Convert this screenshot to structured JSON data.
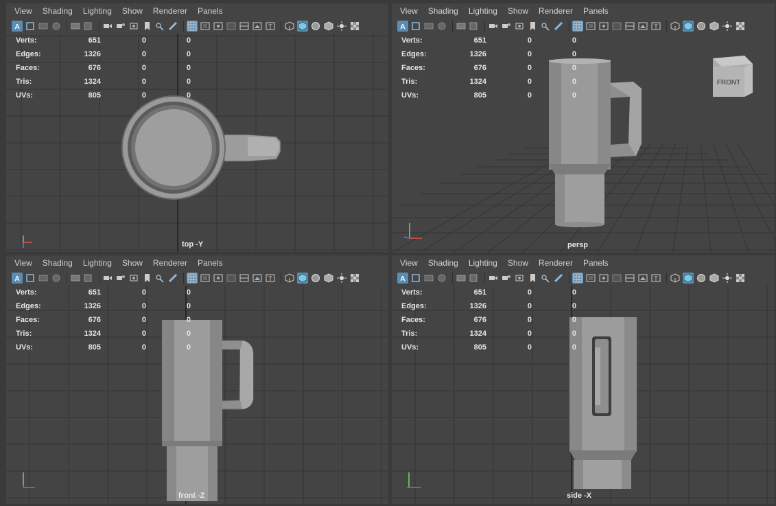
{
  "menus": [
    "View",
    "Shading",
    "Lighting",
    "Show",
    "Renderer",
    "Panels"
  ],
  "toolbar_icons": [
    "select-camera-icon",
    "camera-attributes-icon",
    "bookmark-icon",
    "image-plane-icon",
    "grid-toggle-icon",
    "film-gate-icon",
    "camera-icon",
    "camera-lock-icon",
    "snapshot-icon",
    "bookmark-flag-icon",
    "two-d-pan-icon",
    "grease-pencil-icon",
    "grid-icon",
    "film-gate-frame-icon",
    "resolution-gate-icon",
    "gate-mask-icon",
    "field-chart-icon",
    "safe-action-icon",
    "safe-title-icon",
    "wireframe-icon",
    "smooth-shade-icon",
    "default-material-icon",
    "textured-icon",
    "lights-icon",
    "shadows-icon"
  ],
  "stats": {
    "labels": [
      "Verts:",
      "Edges:",
      "Faces:",
      "Tris:",
      "UVs:"
    ],
    "col1": [
      "651",
      "1326",
      "676",
      "1324",
      "805"
    ],
    "col2": [
      "0",
      "0",
      "0",
      "0",
      "0"
    ],
    "col3": [
      "0",
      "0",
      "0",
      "0",
      "0"
    ]
  },
  "panes": {
    "top": {
      "camera": "top -Y"
    },
    "persp": {
      "camera": "persp",
      "viewcube_label": "FRONT"
    },
    "front": {
      "camera": "front -Z"
    },
    "side": {
      "camera": "side -X"
    }
  },
  "colors": {
    "background": "#444444",
    "grid": "#333333",
    "axis_y": "#6cd46c",
    "axis_x": "#e05050",
    "axis_z": "#5a7ce6",
    "selected_icon": "#5a8db3"
  }
}
